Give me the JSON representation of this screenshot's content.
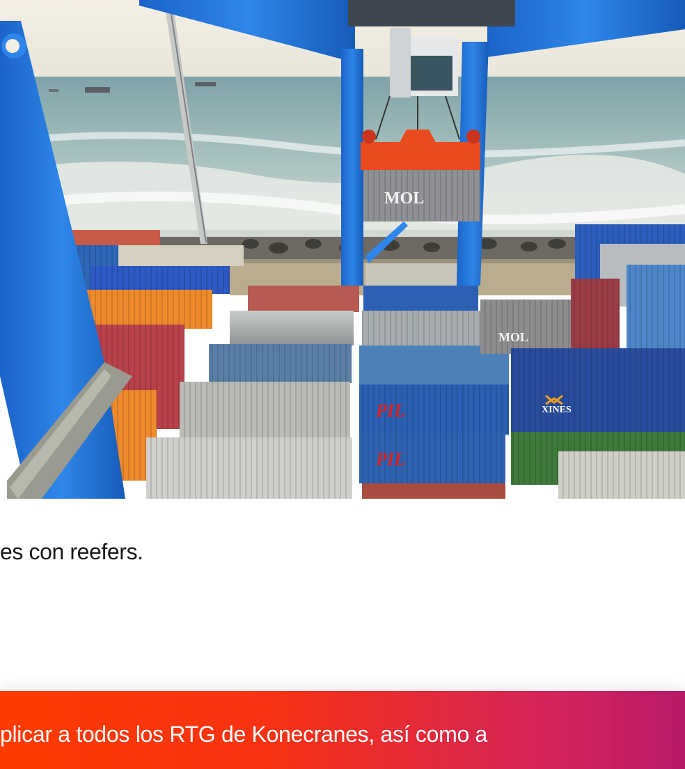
{
  "photo": {
    "container_labels": [
      "MOL",
      "MOL",
      "XINES",
      "PIL",
      "PIL"
    ]
  },
  "caption": {
    "text": "es con reefers."
  },
  "banner": {
    "text": "plicar a todos los RTG de Konecranes, así como a"
  },
  "colors": {
    "banner_start": "#ff3b00",
    "banner_end": "#b81a68",
    "crane_blue": "#1f6fd1"
  }
}
